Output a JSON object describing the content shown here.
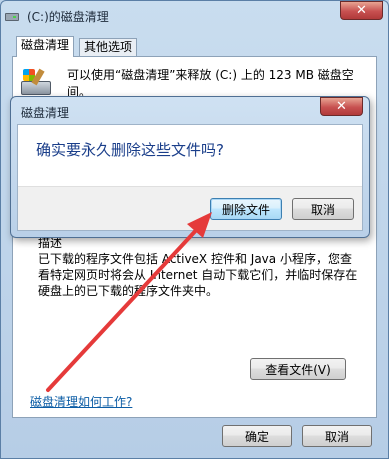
{
  "window": {
    "title": "(C:)的磁盘清理",
    "close_glyph": "✕"
  },
  "tabs": [
    {
      "label": "磁盘清理",
      "active": true
    },
    {
      "label": "其他选项",
      "active": false
    }
  ],
  "summary": {
    "text": "可以使用“磁盘清理”来释放 (C:) 上的 123 MB 磁盘空间。"
  },
  "description": {
    "label": "描述",
    "text": "已下载的程序文件包括 ActiveX 控件和 Java 小程序，您查看特定网页时将会从 Internet 自动下载它们，并临时保存在硬盘上的已下载的程序文件夹中。"
  },
  "buttons": {
    "view_files": "查看文件(V)",
    "ok": "确定",
    "cancel": "取消"
  },
  "link": {
    "how_it_works": "磁盘清理如何工作?"
  },
  "dialog": {
    "title": "磁盘清理",
    "close_glyph": "✕",
    "question": "确实要永久删除这些文件吗?",
    "delete_button": "删除文件",
    "cancel_button": "取消"
  },
  "annotation": {
    "arrow_color": "#e53a3a"
  },
  "icons": [
    "disk-cleanup-app-icon",
    "disk-cleanup-icon",
    "close-icon"
  ]
}
